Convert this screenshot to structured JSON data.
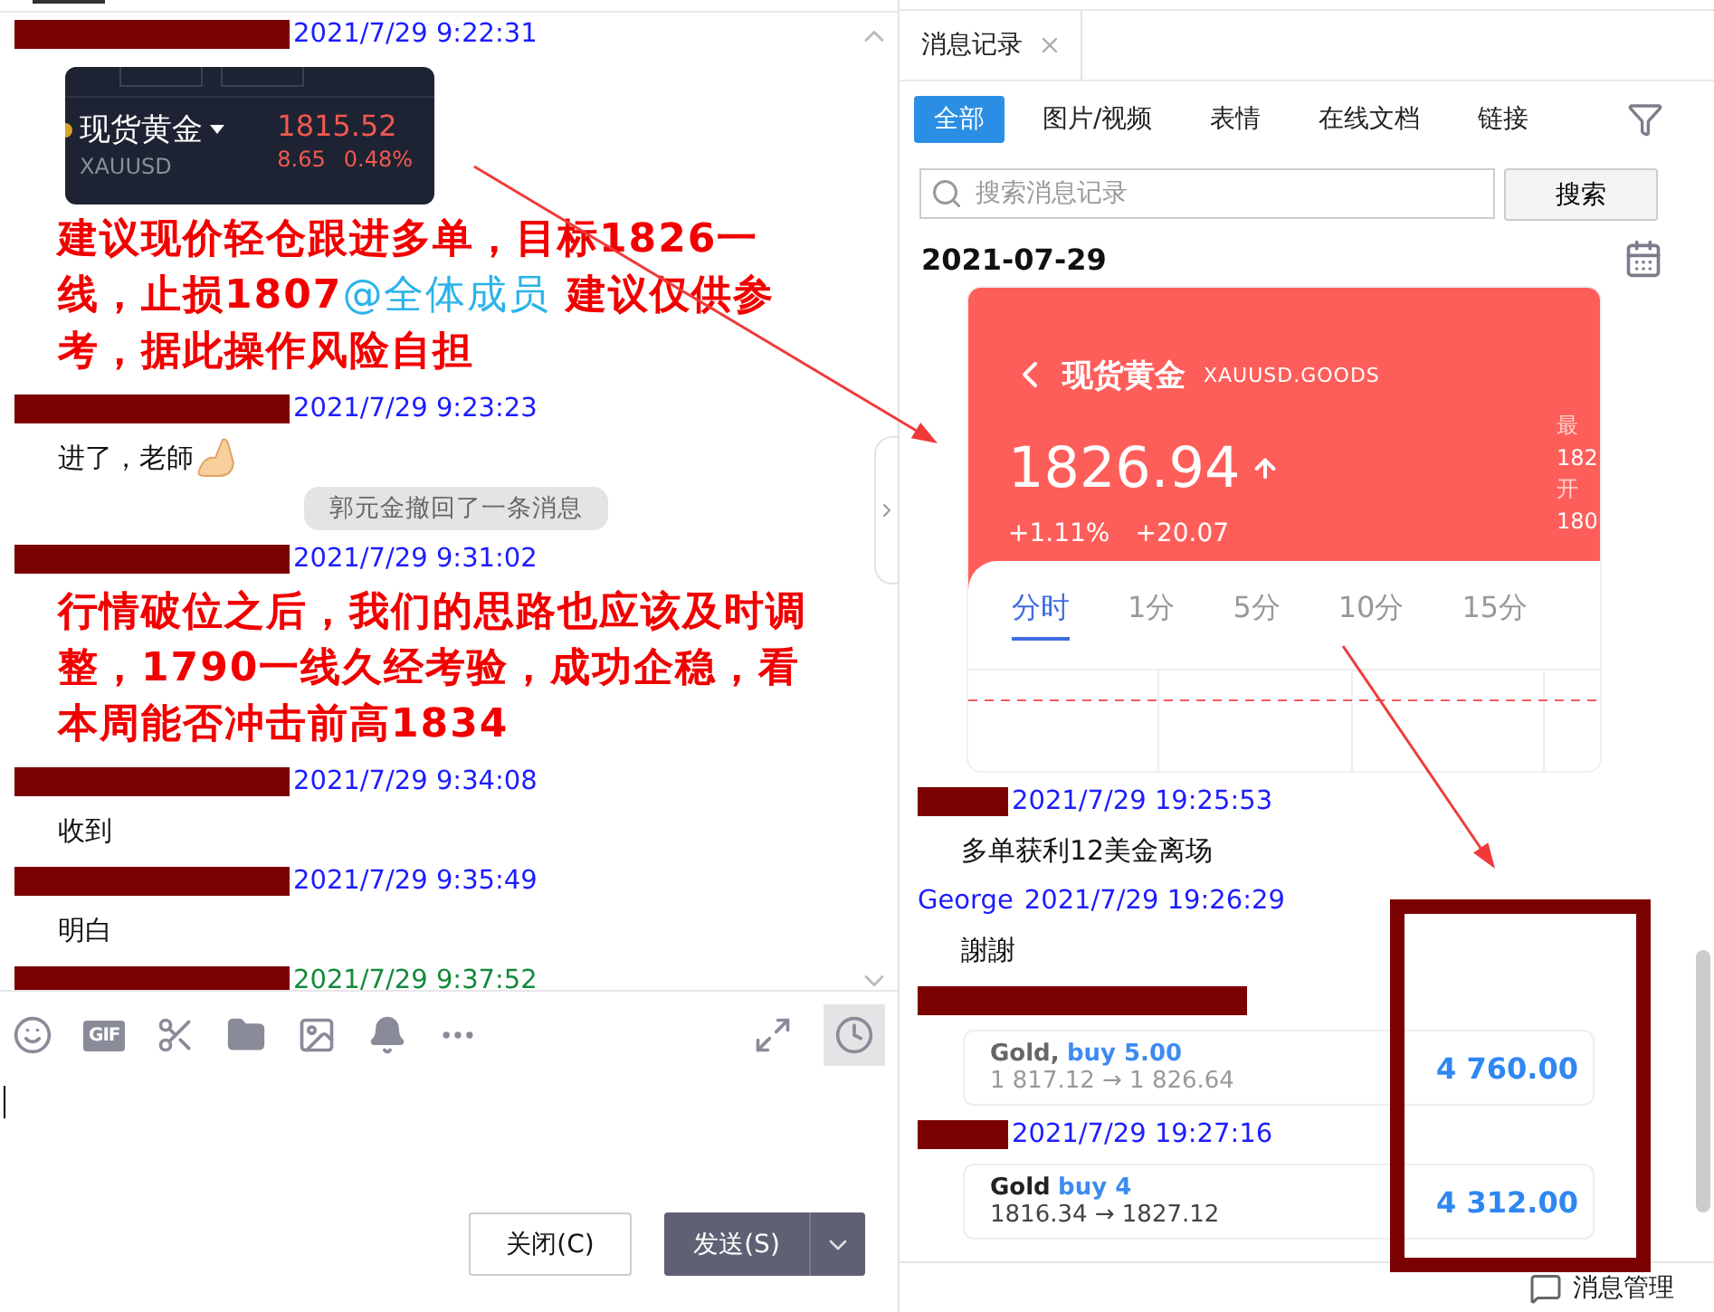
{
  "chat": {
    "items": [
      {
        "kind": "header",
        "sender_redacted": true,
        "time": "2021/7/29 9:22:31",
        "color": "#1c1cff"
      },
      {
        "kind": "quote_card",
        "symbol": "现货黄金",
        "code": "XAUUSD",
        "price": "1815.52",
        "change": "8.65",
        "percent": "0.48%"
      },
      {
        "kind": "alert",
        "before": "建议现价轻仓跟进多单，目标1826一线，止损1807",
        "mention": "@全体成员",
        "after": "  建议仅供参考，据此操作风险自担"
      },
      {
        "kind": "header",
        "sender_redacted": true,
        "time": "2021/7/29 9:23:23",
        "color": "#1c1cff"
      },
      {
        "kind": "text",
        "text": "进了，老師",
        "emoji": true
      },
      {
        "kind": "notice",
        "text": "郭元金撤回了一条消息"
      },
      {
        "kind": "header",
        "sender_redacted": true,
        "time": "2021/7/29 9:31:02",
        "color": "#1c1cff"
      },
      {
        "kind": "alert",
        "before": "行情破位之后，我们的思路也应该及时调整，1790一线久经考验，成功企稳，看本周能否冲击前高1834"
      },
      {
        "kind": "header",
        "sender_redacted": true,
        "time": "2021/7/29 9:34:08",
        "color": "#1c1cff"
      },
      {
        "kind": "text",
        "text": "收到"
      },
      {
        "kind": "header",
        "sender_redacted": true,
        "time": "2021/7/29 9:35:49",
        "color": "#1c1cff"
      },
      {
        "kind": "text",
        "text": "明白"
      },
      {
        "kind": "header",
        "sender_redacted": true,
        "time": "2021/7/29 9:37:52",
        "color": "#138a3c"
      }
    ],
    "toolbar": [
      {
        "kind": "emoji"
      },
      {
        "kind": "gif",
        "label": "GIF"
      },
      {
        "kind": "scissors"
      },
      {
        "kind": "folder"
      },
      {
        "kind": "image"
      },
      {
        "kind": "bell"
      },
      {
        "kind": "more"
      }
    ],
    "buttons": {
      "close": "关闭(C)",
      "send": "发送(S)"
    }
  },
  "history": {
    "tab": {
      "label": "消息记录"
    },
    "filters": [
      {
        "label": "全部",
        "selected": true
      },
      {
        "label": "图片/视频",
        "selected": false
      },
      {
        "label": "表情",
        "selected": false
      },
      {
        "label": "在线文档",
        "selected": false
      },
      {
        "label": "链接",
        "selected": false
      }
    ],
    "search": {
      "placeholder": "搜索消息记录",
      "button": "搜索"
    },
    "date": "2021-07-29",
    "items": [
      {
        "kind": "market_card",
        "title": "现货黄金",
        "code": "XAUUSD.GOODS",
        "price": "1826.94",
        "percent": "+1.11%",
        "change": "+20.07",
        "side": [
          "最",
          "182",
          "开",
          "180"
        ],
        "periods": [
          {
            "label": "分时",
            "selected": true
          },
          {
            "label": "1分",
            "selected": false
          },
          {
            "label": "5分",
            "selected": false
          },
          {
            "label": "10分",
            "selected": false
          },
          {
            "label": "15分",
            "selected": false
          }
        ]
      },
      {
        "kind": "header",
        "sender_redacted": true,
        "time": "2021/7/29 19:25:53",
        "color": "#1c1cff"
      },
      {
        "kind": "text",
        "text": "多单获利12美金离场"
      },
      {
        "kind": "header",
        "sender_redacted": false,
        "sender": "George",
        "time": "2021/7/29 19:26:29",
        "color": "#1c1cff"
      },
      {
        "kind": "text",
        "text": "謝謝"
      },
      {
        "kind": "header",
        "sender_redacted": true
      },
      {
        "kind": "trade_card",
        "asset": "Gold,",
        "action": "buy 5.00",
        "prices": "1 817.12 → 1 826.64",
        "profit": "4 760.00",
        "muted": true
      },
      {
        "kind": "header",
        "sender_redacted": true,
        "time": "2021/7/29 19:27:16",
        "color": "#1c1cff"
      },
      {
        "kind": "trade_card",
        "asset": "Gold",
        "action": "buy 4",
        "prices": "1816.34 → 1827.12",
        "profit": "4 312.00",
        "muted": false
      }
    ],
    "footer": {
      "label": "消息管理"
    }
  }
}
